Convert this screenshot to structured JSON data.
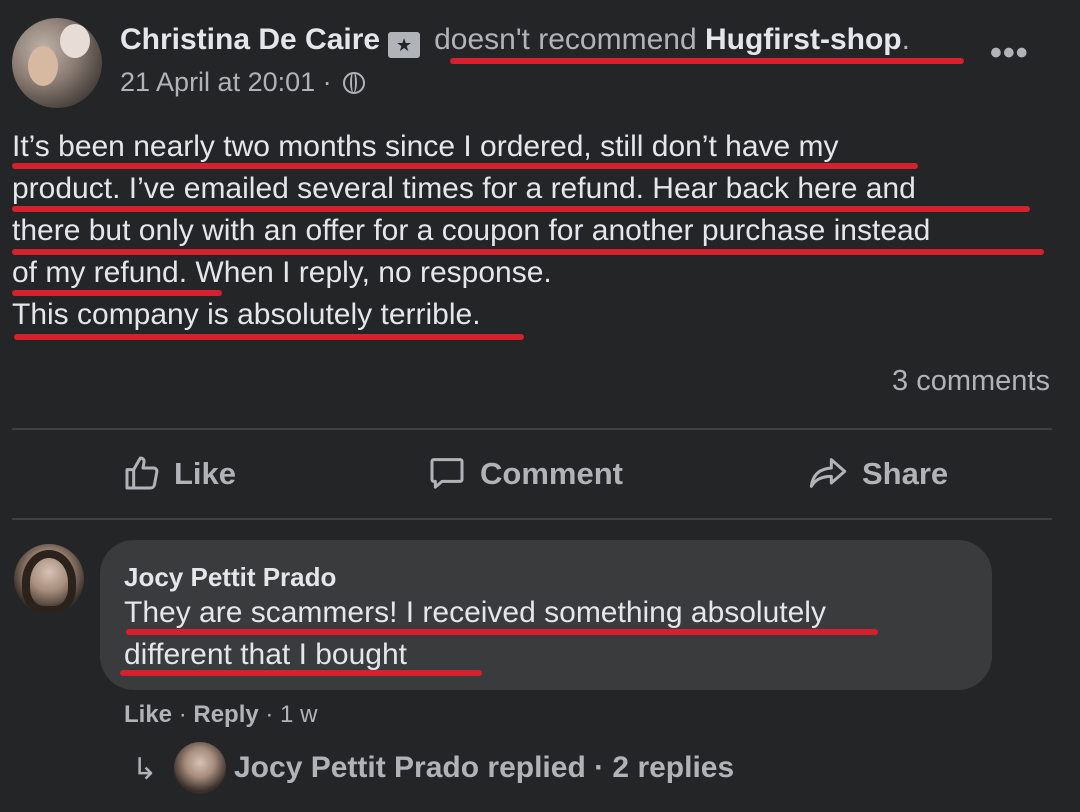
{
  "post": {
    "author": "Christina De Caire",
    "recommend_phrase": "doesn't recommend",
    "page_name": "Hugfirst-shop",
    "page_suffix": ".",
    "timestamp": "21 April at 20:01 ·",
    "privacy_icon": "globe-icon",
    "more_icon": "•••",
    "text_lines": [
      "It’s been nearly two months since I ordered, still don’t have my",
      "product. I’ve emailed several times for a refund. Hear back here and",
      "there but only with an offer for a coupon for another purchase instead",
      "of my refund. When I reply, no response.",
      "This company is absolutely terrible."
    ],
    "comment_count": "3 comments"
  },
  "actions": {
    "like": "Like",
    "comment": "Comment",
    "share": "Share"
  },
  "comment": {
    "author": "Jocy Pettit Prado",
    "text_lines": [
      "They are scammers! I received something absolutely",
      "different that I bought"
    ],
    "like": "Like",
    "sep1": " · ",
    "reply": "Reply",
    "sep2": " · ",
    "age": "1 w"
  },
  "replies": {
    "arrow": "↳",
    "summary": "Jocy Pettit Prado replied · 2 replies"
  },
  "colors": {
    "background": "#242526",
    "bubble": "#3a3b3c",
    "text": "#e4e6eb",
    "secondary_text": "#b0b3b8",
    "annotation_underline": "#d71f2d"
  }
}
